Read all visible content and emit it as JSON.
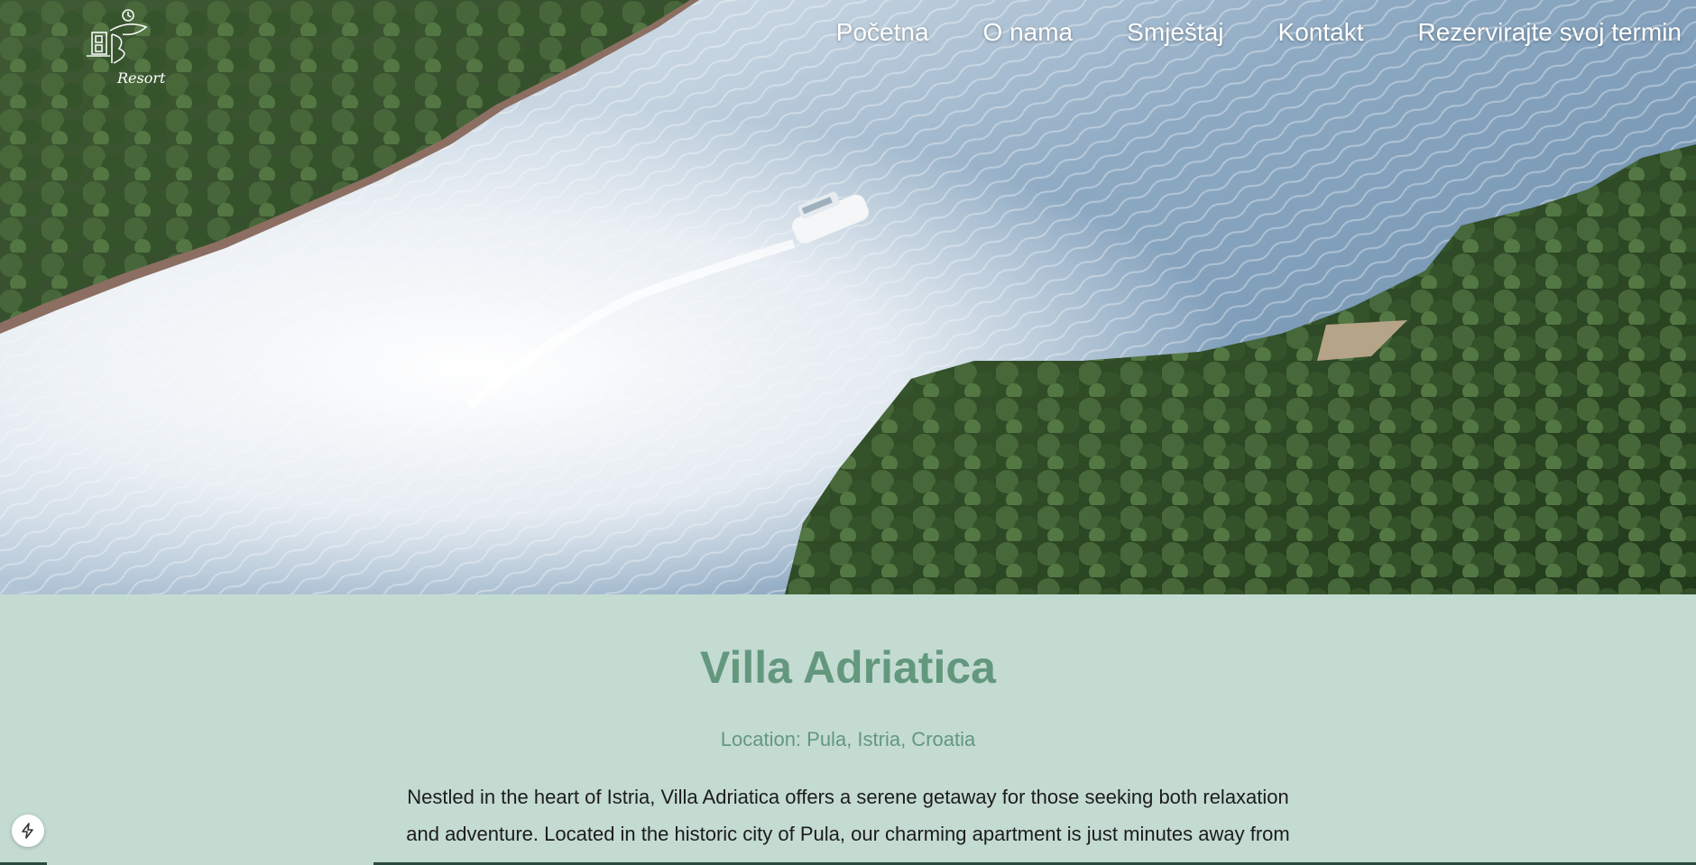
{
  "header": {
    "logo_text": "Resort",
    "nav": [
      {
        "label": "Početna"
      },
      {
        "label": "O nama"
      },
      {
        "label": "Smještaj"
      },
      {
        "label": "Kontakt"
      },
      {
        "label": "Rezervirajte svoj termin"
      }
    ]
  },
  "hero": {
    "image_icon": "aerial-coast-boat-image"
  },
  "main": {
    "title": "Villa Adriatica",
    "location": "Location: Pula, Istria, Croatia",
    "description": "Nestled in the heart of Istria, Villa Adriatica offers a serene getaway for those seeking both relaxation and adventure. Located in the historic city of Pula, our charming apartment is just minutes away from stunning beaches, ancient Roman ruins, and vibrant local culture. Whether you're here to enjoy"
  },
  "badge": {
    "icon": "lightning-icon"
  },
  "colors": {
    "accent": "#63987e",
    "background": "#c4dbd2",
    "nav_text": "#ffffff",
    "body_text": "#1c1c1c"
  }
}
